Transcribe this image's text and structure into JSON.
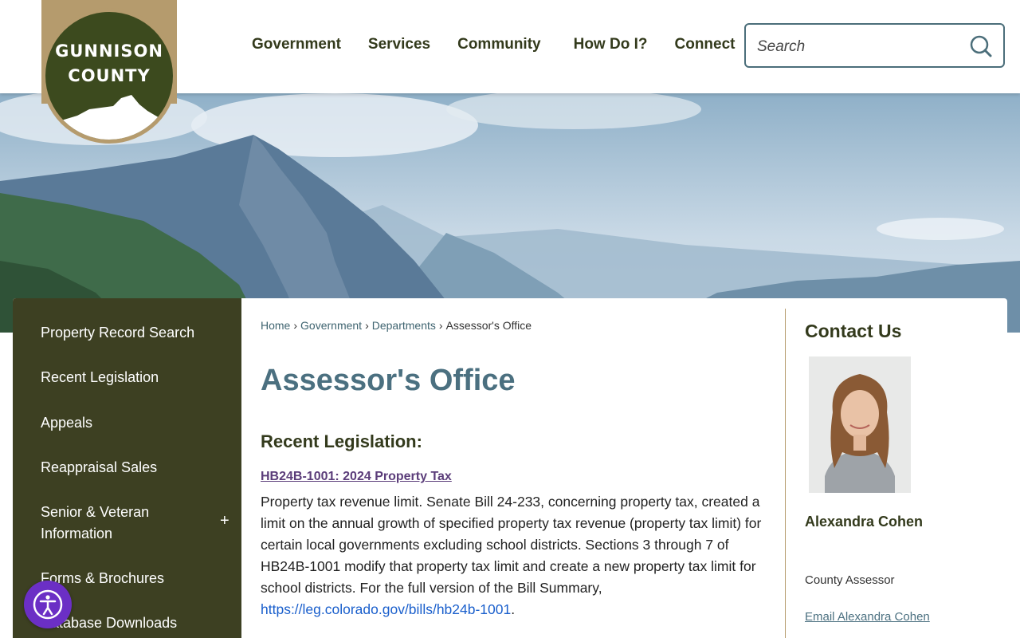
{
  "logo": {
    "line1": "GUNNISON",
    "line2": "COUNTY"
  },
  "nav": {
    "items": [
      {
        "label": "Government"
      },
      {
        "label": "Services"
      },
      {
        "label": "Community"
      },
      {
        "label": "How Do I?"
      },
      {
        "label": "Connect"
      }
    ]
  },
  "search": {
    "placeholder": "Search",
    "icon": "search-icon"
  },
  "sidebar": {
    "items": [
      {
        "label": "Property Record Search"
      },
      {
        "label": "Recent Legislation"
      },
      {
        "label": "Appeals"
      },
      {
        "label": "Reappraisal Sales"
      },
      {
        "label": "Senior & Veteran Information",
        "expand": "+"
      },
      {
        "label": "Forms & Brochures"
      },
      {
        "label": "Database Downloads"
      }
    ]
  },
  "breadcrumb": {
    "items": [
      "Home",
      "Government",
      "Departments"
    ],
    "separator": "›",
    "current": "Assessor's Office"
  },
  "main": {
    "title": "Assessor's Office",
    "section_heading": "Recent Legislation:",
    "item_title": "HB24B-1001: 2024 Property Tax",
    "body": "Property tax revenue limit. Senate Bill 24-233, concerning property tax, created a limit on the annual growth of specified property tax revenue (property tax limit) for certain local governments excluding school districts. Sections 3 through 7 of HB24B-1001 modify that property tax limit and create a new property tax limit for school districts. For the full version of the Bill Summary, ",
    "link": "https://leg.colorado.gov/bills/hb24b-1001",
    "end": "."
  },
  "contact": {
    "title": "Contact Us",
    "name": "Alexandra Cohen",
    "role": "County Assessor",
    "email_label": "Email Alexandra Cohen"
  },
  "accessibility": {
    "icon": "accessibility-icon"
  },
  "colors": {
    "brand_olive": "#3d4022",
    "brand_tan": "#b59b6d",
    "title_blue": "#4b7080",
    "link_purple": "#5b3d7a",
    "access_purple": "#6b2fc5"
  }
}
